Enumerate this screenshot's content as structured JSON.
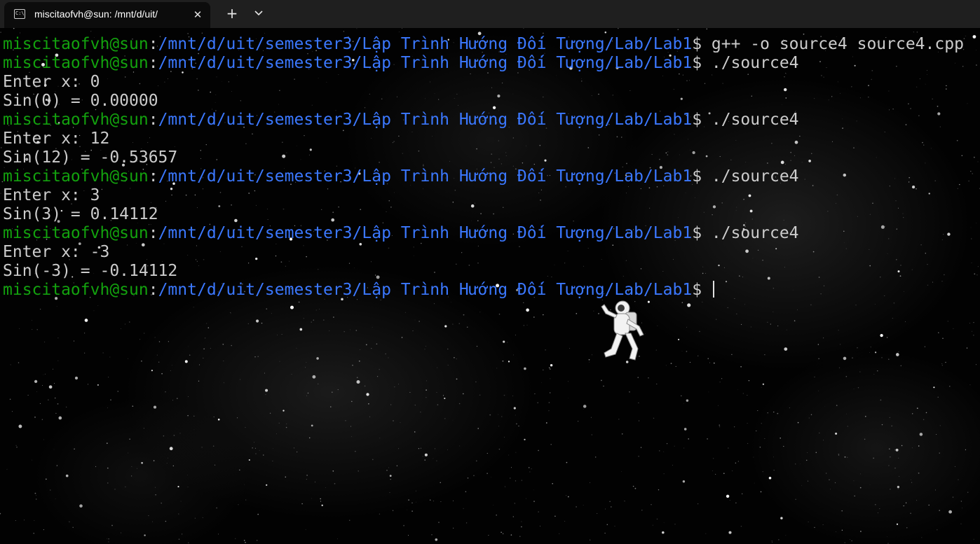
{
  "window": {
    "tab_title": "miscitaofvh@sun: /mnt/d/uit/",
    "tab_icon": "terminal-icon",
    "close_icon": "close-icon",
    "new_tab_icon": "plus-icon",
    "dropdown_icon": "chevron-down-icon"
  },
  "prompt": {
    "user": "miscitaofvh@sun",
    "sep": ":",
    "path": "/mnt/d/uit/semester3/Lập Trình Hướng Đối Tượng/Lab/Lab1",
    "dollar": "$ "
  },
  "lines": [
    {
      "type": "prompt",
      "command": "g++ -o source4 source4.cpp"
    },
    {
      "type": "prompt",
      "command": "./source4"
    },
    {
      "type": "output",
      "text": "Enter x: 0"
    },
    {
      "type": "output",
      "text": "Sin(0) = 0.00000"
    },
    {
      "type": "prompt",
      "command": "./source4"
    },
    {
      "type": "output",
      "text": "Enter x: 12"
    },
    {
      "type": "output",
      "text": "Sin(12) = -0.53657"
    },
    {
      "type": "prompt",
      "command": "./source4"
    },
    {
      "type": "output",
      "text": "Enter x: 3"
    },
    {
      "type": "output",
      "text": "Sin(3) = 0.14112"
    },
    {
      "type": "prompt",
      "command": "./source4"
    },
    {
      "type": "output",
      "text": "Enter x: -3"
    },
    {
      "type": "output",
      "text": "Sin(-3) = -0.14112"
    },
    {
      "type": "prompt",
      "command": "",
      "cursor": true
    }
  ],
  "colors": {
    "user": "#13a10e",
    "path": "#3b78ff",
    "text": "#cccccc",
    "background": "#000000",
    "tabbar": "#1f1f1f"
  }
}
